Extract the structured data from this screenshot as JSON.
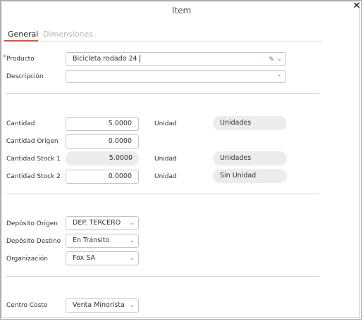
{
  "dialog": {
    "title": "Item",
    "close_glyph": "✕"
  },
  "tabs": [
    {
      "label": "General",
      "active": true
    },
    {
      "label": "Dimensiones",
      "active": false
    }
  ],
  "form": {
    "producto": {
      "label": "Producto",
      "value": "Bicicleta rodado 24",
      "required": true
    },
    "descripcion": {
      "label": "Descripción",
      "value": ""
    },
    "cantidad": {
      "label": "Cantidad",
      "value": "5.0000",
      "unit_label": "Unidad",
      "unit_value": "Unidades"
    },
    "cantidad_origen": {
      "label": "Cantidad Origen",
      "value": "0.0000"
    },
    "cantidad_stock1": {
      "label": "Cantidad Stock 1",
      "value": "5.0000",
      "unit_label": "Unidad",
      "unit_value": "Unidades"
    },
    "cantidad_stock2": {
      "label": "Cantidad Stock 2",
      "value": "0.0000",
      "unit_label": "Unidad",
      "unit_value": "Sin Unidad"
    },
    "deposito_origen": {
      "label": "Depósito Origen",
      "value": "DEP. TERCERO"
    },
    "deposito_destino": {
      "label": "Depósito Destino",
      "value": "En Tránsito"
    },
    "organizacion": {
      "label": "Organización",
      "value": "Fox SA"
    },
    "centro_costo": {
      "label": "Centro Costo",
      "value": "Venta Minorista"
    }
  },
  "icons": {
    "chevron": "chevron-down-icon",
    "edit": "pencil-icon",
    "close": "close-icon"
  },
  "colors": {
    "accent": "#d9533b",
    "chevron": "#4a8fd8",
    "pill_bg": "#ececec"
  }
}
